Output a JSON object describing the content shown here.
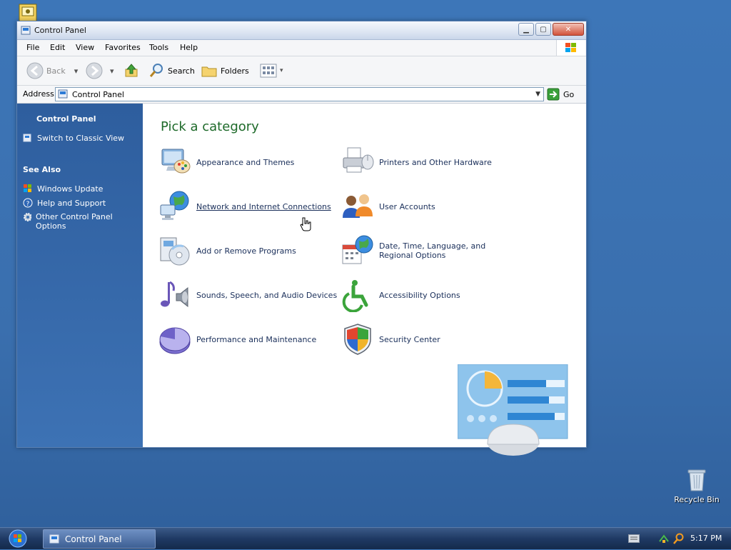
{
  "desktop": {
    "recycle_bin_label": "Recycle Bin"
  },
  "window": {
    "title": "Control Panel",
    "menu": [
      "File",
      "Edit",
      "View",
      "Favorites",
      "Tools",
      "Help"
    ],
    "toolbar": {
      "back": "Back",
      "search": "Search",
      "folders": "Folders"
    },
    "address": {
      "label": "Address",
      "value": "Control Panel",
      "go": "Go"
    }
  },
  "sidebar": {
    "title": "Control Panel",
    "switch_view": "Switch to Classic View",
    "see_also_title": "See Also",
    "see_also": [
      "Windows Update",
      "Help and Support",
      "Other Control Panel Options"
    ]
  },
  "main": {
    "heading": "Pick a category",
    "categories": [
      {
        "label": "Appearance and Themes",
        "icon": "appearance-icon"
      },
      {
        "label": "Printers and Other Hardware",
        "icon": "printer-icon"
      },
      {
        "label": "Network and Internet Connections",
        "icon": "network-icon"
      },
      {
        "label": "User Accounts",
        "icon": "users-icon"
      },
      {
        "label": "Add or Remove Programs",
        "icon": "programs-icon"
      },
      {
        "label": "Date, Time, Language, and Regional Options",
        "icon": "datetime-icon"
      },
      {
        "label": "Sounds, Speech, and Audio Devices",
        "icon": "sound-icon"
      },
      {
        "label": "Accessibility Options",
        "icon": "accessibility-icon"
      },
      {
        "label": "Performance and Maintenance",
        "icon": "performance-icon"
      },
      {
        "label": "Security Center",
        "icon": "shield-icon"
      }
    ]
  },
  "taskbar": {
    "task": "Control Panel",
    "clock": "5:17 PM"
  }
}
